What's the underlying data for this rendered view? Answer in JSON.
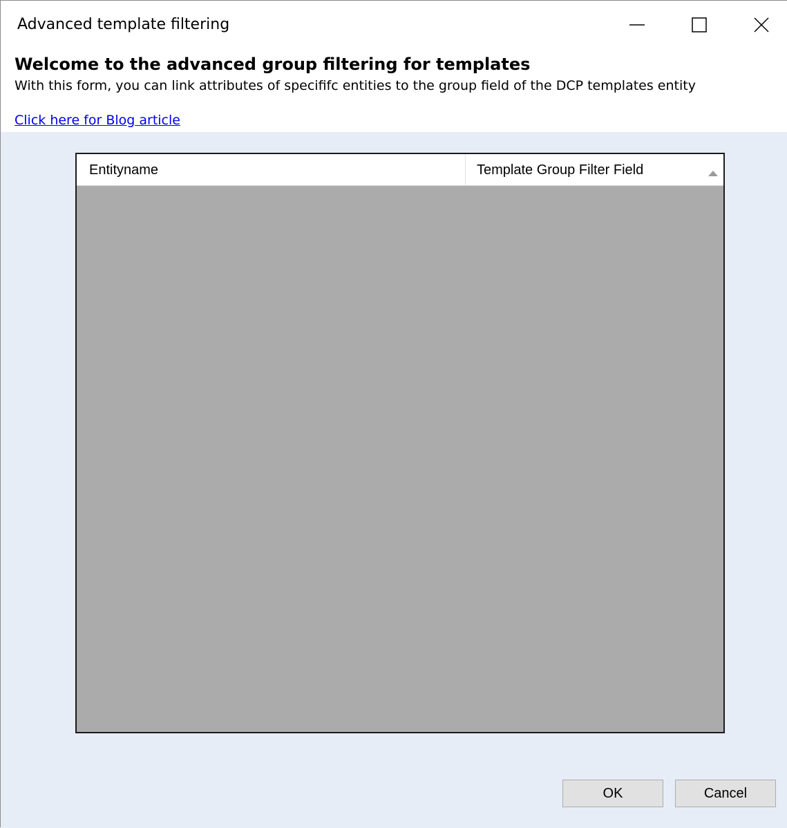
{
  "window": {
    "title": "Advanced template filtering",
    "controls": {
      "minimize": "minimize-icon",
      "maximize": "maximize-icon",
      "close": "close-icon"
    }
  },
  "header": {
    "welcome": "Welcome to the advanced group filtering for templates",
    "description": "With this form, you can link attributes of specififc entities to the group field of the DCP templates entity",
    "blog_link": "Click here for Blog article"
  },
  "grid": {
    "columns": [
      "Entityname",
      "Template Group Filter Field"
    ],
    "sort_icon": "sort-ascending-icon",
    "rows": []
  },
  "buttons": {
    "ok": "OK",
    "cancel": "Cancel"
  },
  "colors": {
    "panel_background": "#e6edf6",
    "grid_background": "#ababab",
    "link": "#0000ee"
  }
}
